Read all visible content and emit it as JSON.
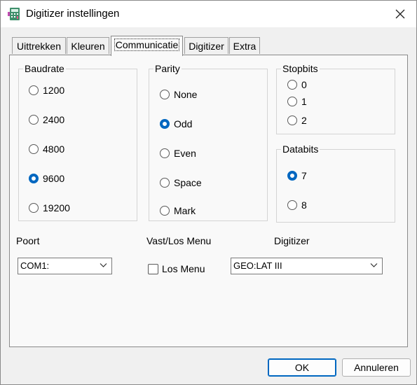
{
  "window": {
    "title": "Digitizer instellingen"
  },
  "tabs": [
    {
      "label": "Uittrekken",
      "active": false
    },
    {
      "label": "Kleuren",
      "active": false
    },
    {
      "label": "Communicatie",
      "active": true
    },
    {
      "label": "Digitizer",
      "active": false
    },
    {
      "label": "Extra",
      "active": false
    }
  ],
  "baudrate": {
    "title": "Baudrate",
    "options": [
      "1200",
      "2400",
      "4800",
      "9600",
      "19200"
    ],
    "selected": "9600"
  },
  "parity": {
    "title": "Parity",
    "options": [
      "None",
      "Odd",
      "Even",
      "Space",
      "Mark"
    ],
    "selected": "Odd"
  },
  "stopbits": {
    "title": "Stopbits",
    "options": [
      "0",
      "1",
      "2"
    ],
    "selected": null
  },
  "databits": {
    "title": "Databits",
    "options": [
      "7",
      "8"
    ],
    "selected": "7"
  },
  "poort": {
    "label": "Poort",
    "value": "COM1:"
  },
  "menu": {
    "label": "Vast/Los Menu",
    "checkbox_label": "Los Menu",
    "checked": false
  },
  "digitizer": {
    "label": "Digitizer",
    "value": "GEO:LAT III"
  },
  "buttons": {
    "ok": "OK",
    "cancel": "Annuleren"
  },
  "colors": {
    "accent": "#0067c0"
  }
}
